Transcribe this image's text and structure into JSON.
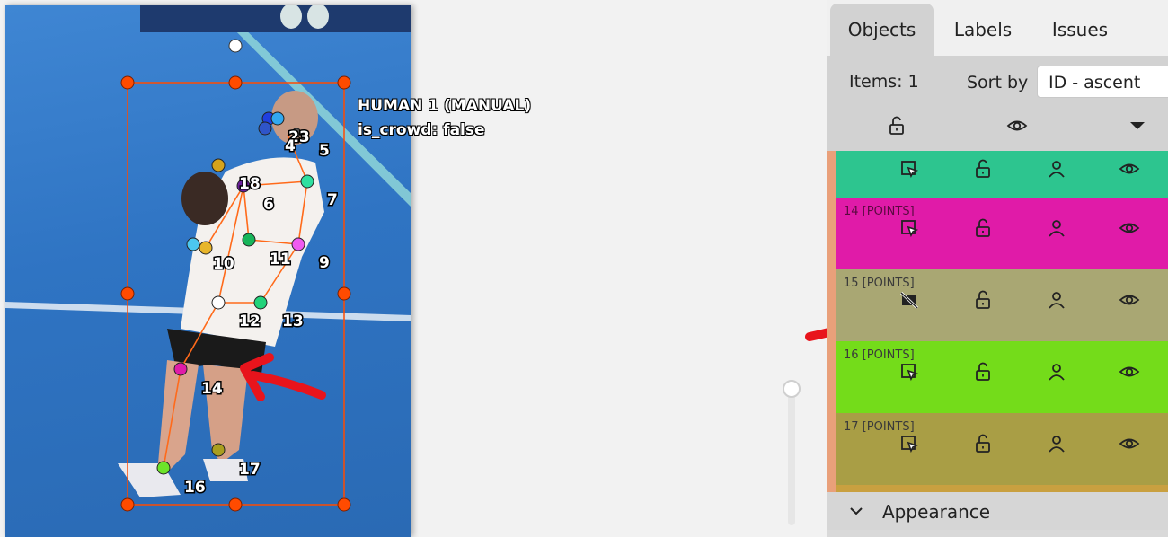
{
  "canvas": {
    "object_caption": {
      "title": "HUMAN 1 (MANUAL)",
      "attribute": "is_crowd: false"
    },
    "keypoint_labels": [
      "23",
      "4",
      "5",
      "18",
      "6",
      "7",
      "10",
      "11",
      "9",
      "12",
      "13",
      "14",
      "17",
      "16"
    ],
    "colors": {
      "bbox": "#ff4b00",
      "skeleton": "#ff6a1a",
      "annotation_arrow": "#e8141c"
    }
  },
  "sidebar": {
    "tabs": [
      {
        "label": "Objects",
        "active": true
      },
      {
        "label": "Labels",
        "active": false
      },
      {
        "label": "Issues",
        "active": false
      }
    ],
    "items_label": "Items: 1",
    "sort_label": "Sort by",
    "sort_value": "ID - ascent",
    "header_icons": [
      "unlock-icon",
      "eye-icon",
      "caret-down-icon"
    ],
    "rows": [
      {
        "label": "",
        "color": "#2dc58f",
        "first_icon": "select-icon"
      },
      {
        "label": "14 [POINTS]",
        "color": "#e01ba8",
        "first_icon": "select-icon"
      },
      {
        "label": "15 [POINTS]",
        "color": "#a9a773",
        "first_icon": "hidden-icon"
      },
      {
        "label": "16 [POINTS]",
        "color": "#74dc1a",
        "first_icon": "select-icon"
      },
      {
        "label": "17 [POINTS]",
        "color": "#a99e45",
        "first_icon": "select-icon"
      }
    ],
    "appearance_label": "Appearance"
  }
}
